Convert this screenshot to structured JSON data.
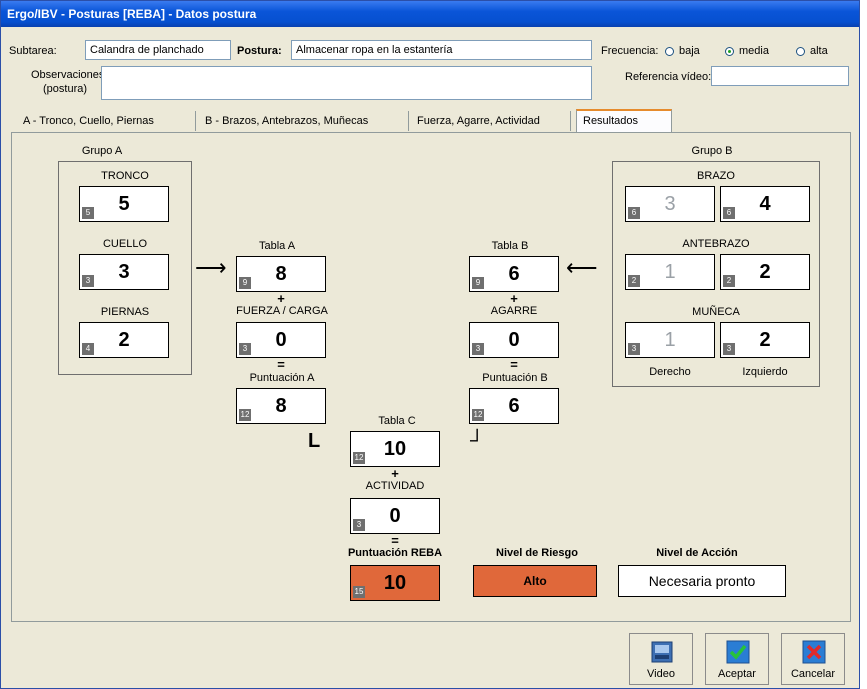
{
  "window": {
    "title": "Ergo/IBV - Posturas [REBA] - Datos postura"
  },
  "header": {
    "subtarea_label": "Subtarea:",
    "subtarea_value": "Calandra de planchado",
    "postura_label": "Postura:",
    "postura_value": "Almacenar ropa en la estantería",
    "frecuencia_label": "Frecuencia:",
    "frecuencia_options": [
      "baja",
      "media",
      "alta"
    ],
    "frecuencia_selected": "media",
    "observaciones_label_1": "Observaciones:",
    "observaciones_label_2": "(postura)",
    "observaciones_value": "",
    "referencia_label": "Referencia vídeo:",
    "referencia_value": ""
  },
  "tabs": [
    {
      "label": "A - Tronco, Cuello, Piernas"
    },
    {
      "label": "B - Brazos, Antebrazos, Muñecas"
    },
    {
      "label": "Fuerza, Agarre, Actividad"
    },
    {
      "label": "Resultados"
    }
  ],
  "grupo_a": {
    "title": "Grupo A",
    "tronco": {
      "label": "TRONCO",
      "value": "5",
      "small": "5"
    },
    "cuello": {
      "label": "CUELLO",
      "value": "3",
      "small": "3"
    },
    "piernas": {
      "label": "PIERNAS",
      "value": "2",
      "small": "4"
    }
  },
  "grupo_b": {
    "title": "Grupo B",
    "brazo": {
      "label": "BRAZO",
      "der": "3",
      "der_small": "6",
      "izq": "4",
      "izq_small": "6"
    },
    "antebrazo": {
      "label": "ANTEBRAZO",
      "der": "1",
      "der_small": "2",
      "izq": "2",
      "izq_small": "2"
    },
    "muneca": {
      "label": "MUÑECA",
      "der": "1",
      "der_small": "3",
      "izq": "2",
      "izq_small": "3"
    },
    "derecho": "Derecho",
    "izquierdo": "Izquierdo"
  },
  "calc_a": {
    "tabla_label": "Tabla A",
    "tabla_value": "8",
    "tabla_small": "9",
    "plus": "+",
    "fuerza_label": "FUERZA / CARGA",
    "fuerza_value": "0",
    "fuerza_small": "3",
    "eq": "=",
    "punt_label": "Puntuación A",
    "punt_value": "8",
    "punt_small": "12"
  },
  "calc_b": {
    "tabla_label": "Tabla B",
    "tabla_value": "6",
    "tabla_small": "9",
    "plus": "+",
    "agarre_label": "AGARRE",
    "agarre_value": "0",
    "agarre_small": "3",
    "eq": "=",
    "punt_label": "Puntuación B",
    "punt_value": "6",
    "punt_small": "12"
  },
  "calc_c": {
    "tabla_label": "Tabla C",
    "tabla_value": "10",
    "tabla_small": "12",
    "plus": "+",
    "actividad_label": "ACTIVIDAD",
    "actividad_value": "0",
    "actividad_small": "3",
    "eq": "="
  },
  "result": {
    "reba_label": "Puntuación REBA",
    "reba_value": "10",
    "reba_small": "15",
    "riesgo_label": "Nivel de Riesgo",
    "riesgo_value": "Alto",
    "accion_label": "Nivel de Acción",
    "accion_value": "Necesaria pronto"
  },
  "buttons": {
    "video": "Video",
    "aceptar": "Aceptar",
    "cancelar": "Cancelar"
  },
  "colors": {
    "risk": "#e0683a",
    "titlebar": "#0a55d8"
  }
}
